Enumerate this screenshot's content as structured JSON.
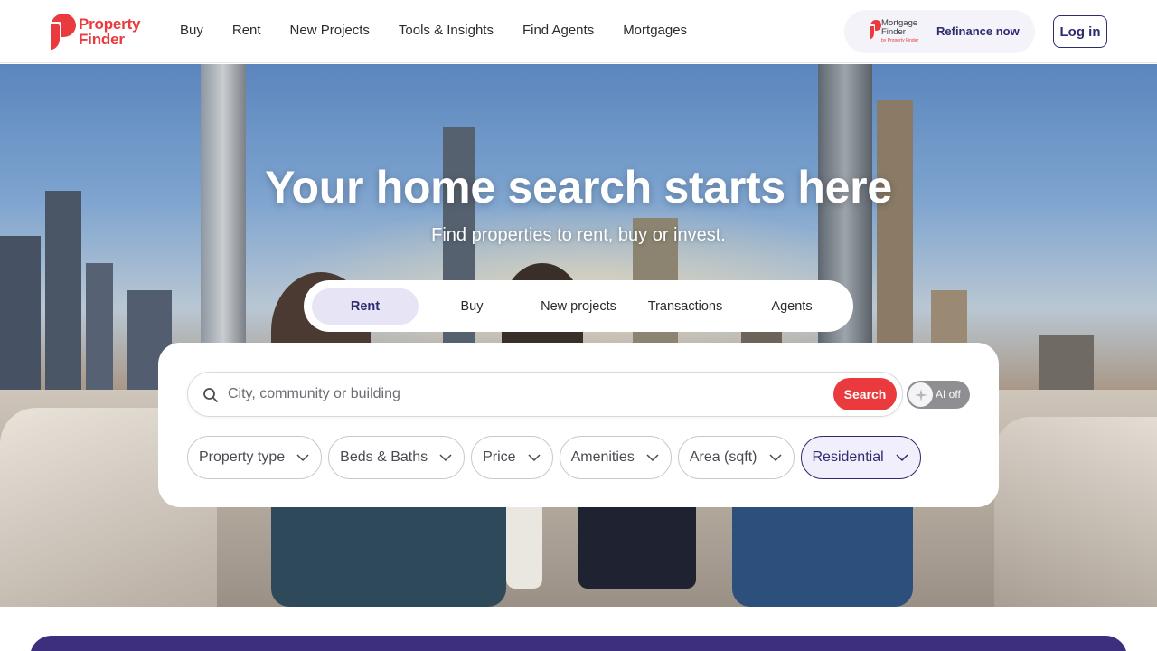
{
  "header": {
    "logo_line1": "Property",
    "logo_line2": "Finder",
    "nav": [
      "Buy",
      "Rent",
      "New Projects",
      "Tools & Insights",
      "Find Agents",
      "Mortgages"
    ],
    "mortgage_logo_line1": "Mortgage",
    "mortgage_logo_line2": "Finder",
    "mortgage_logo_sub": "by Property Finder",
    "refinance_label": "Refinance now",
    "login_label": "Log in"
  },
  "hero": {
    "title": "Your home search starts here",
    "subtitle": "Find properties to rent, buy or invest.",
    "tabs": [
      "Rent",
      "Buy",
      "New projects",
      "Transactions",
      "Agents"
    ],
    "active_tab": "Rent"
  },
  "search": {
    "placeholder": "City, community or building",
    "value": "",
    "button_label": "Search",
    "ai_label": "AI off",
    "filters": [
      "Property type",
      "Beds & Baths",
      "Price",
      "Amenities",
      "Area (sqft)",
      "Residential"
    ],
    "selected_filter": "Residential"
  },
  "colors": {
    "brand_red": "#ea3a3e",
    "brand_navy": "#2d2c6f",
    "band_purple": "#3e2f7e"
  }
}
